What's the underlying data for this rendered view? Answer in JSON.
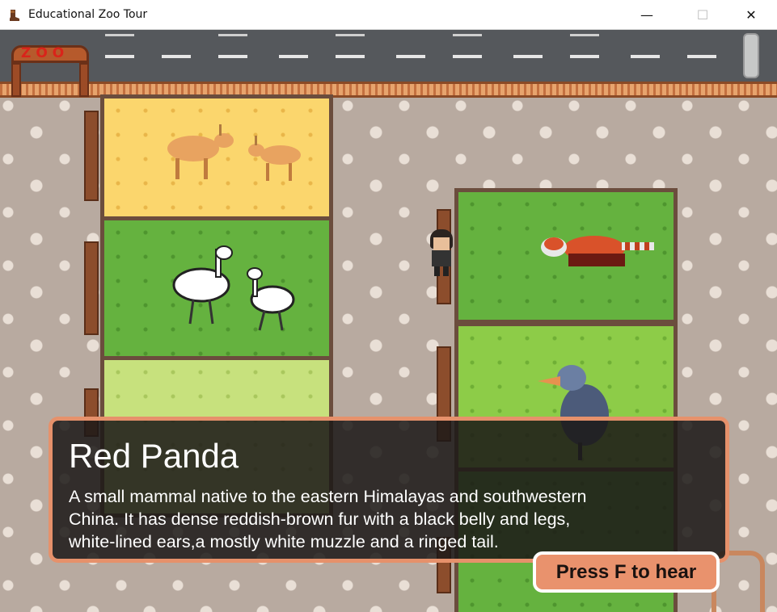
{
  "window": {
    "title": "Educational Zoo Tour",
    "minimize": "—",
    "maximize": "☐",
    "close": "✕"
  },
  "gate": {
    "sign": "ZOO"
  },
  "dialog": {
    "title": "Red Panda",
    "description": "A small mammal native to the eastern Himalayas and southwestern\nChina. It has dense reddish-brown fur with a black belly and legs,\nwhite-lined ears,a mostly white muzzle and a ringed tail."
  },
  "hear_button": {
    "label": "Press F to hear"
  },
  "enclosures": [
    {
      "animal": "saiga antelope",
      "ground": "sand"
    },
    {
      "animal": "emu",
      "ground": "grass"
    },
    {
      "animal": "unknown",
      "ground": "pale-grass"
    },
    {
      "animal": "red panda",
      "ground": "grass"
    },
    {
      "animal": "shoebill",
      "ground": "bright-grass"
    }
  ],
  "colors": {
    "dialog_border": "#e6916b",
    "button_bg": "#e9926d",
    "fence": "#c4703f"
  }
}
